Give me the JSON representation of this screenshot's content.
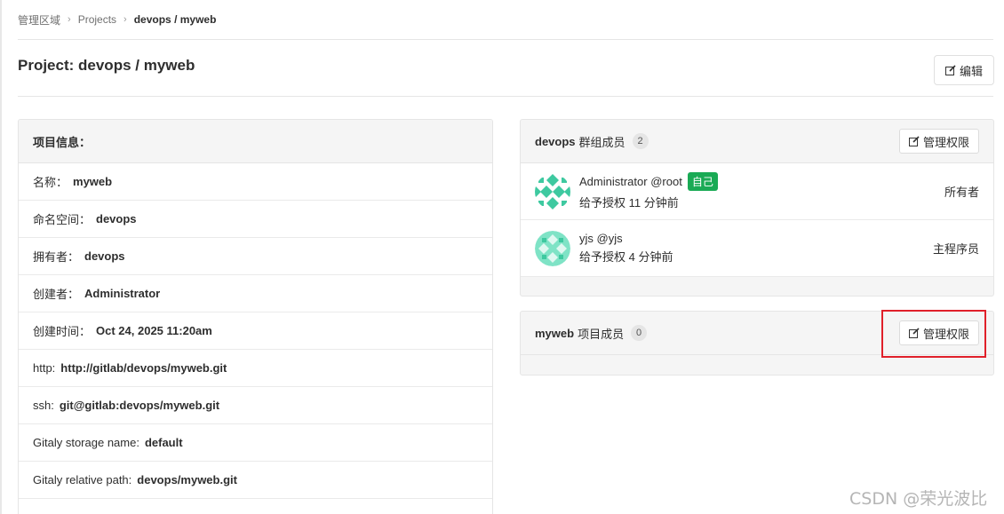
{
  "breadcrumb": {
    "items": [
      "管理区域",
      "Projects"
    ],
    "current": "devops / myweb"
  },
  "page": {
    "title": "Project: devops / myweb",
    "edit_label": "编辑"
  },
  "project_info": {
    "header": "项目信息：",
    "rows": [
      {
        "key": "名称：",
        "value": "myweb"
      },
      {
        "key": "命名空间：",
        "value": "devops"
      },
      {
        "key": "拥有者：",
        "value": "devops"
      },
      {
        "key": "创建者：",
        "value": "Administrator"
      },
      {
        "key": "创建时间：",
        "value": "Oct 24, 2025 11:20am"
      },
      {
        "key": "http:",
        "value": "http://gitlab/devops/myweb.git"
      },
      {
        "key": "ssh:",
        "value": "git@gitlab:devops/myweb.git"
      },
      {
        "key": "Gitaly storage name:",
        "value": "default"
      },
      {
        "key": "Gitaly relative path:",
        "value": "devops/myweb.git"
      }
    ]
  },
  "group_members": {
    "name": "devops",
    "label": "群组成员",
    "count": "2",
    "manage_label": "管理权限",
    "members": [
      {
        "name": "Administrator",
        "handle": "@root",
        "badge": "自己",
        "granted": "给予授权 11 分钟前",
        "role": "所有者"
      },
      {
        "name": "yjs",
        "handle": "@yjs",
        "badge": "",
        "granted": "给予授权 4 分钟前",
        "role": "主程序员"
      }
    ]
  },
  "project_members": {
    "name": "myweb",
    "label": "项目成员",
    "count": "0",
    "manage_label": "管理权限"
  },
  "colors": {
    "success_badge": "#1aaa55",
    "highlight": "#e0202a",
    "avatar_green": "#3ec9a0"
  },
  "watermark": "CSDN @荣光波比"
}
